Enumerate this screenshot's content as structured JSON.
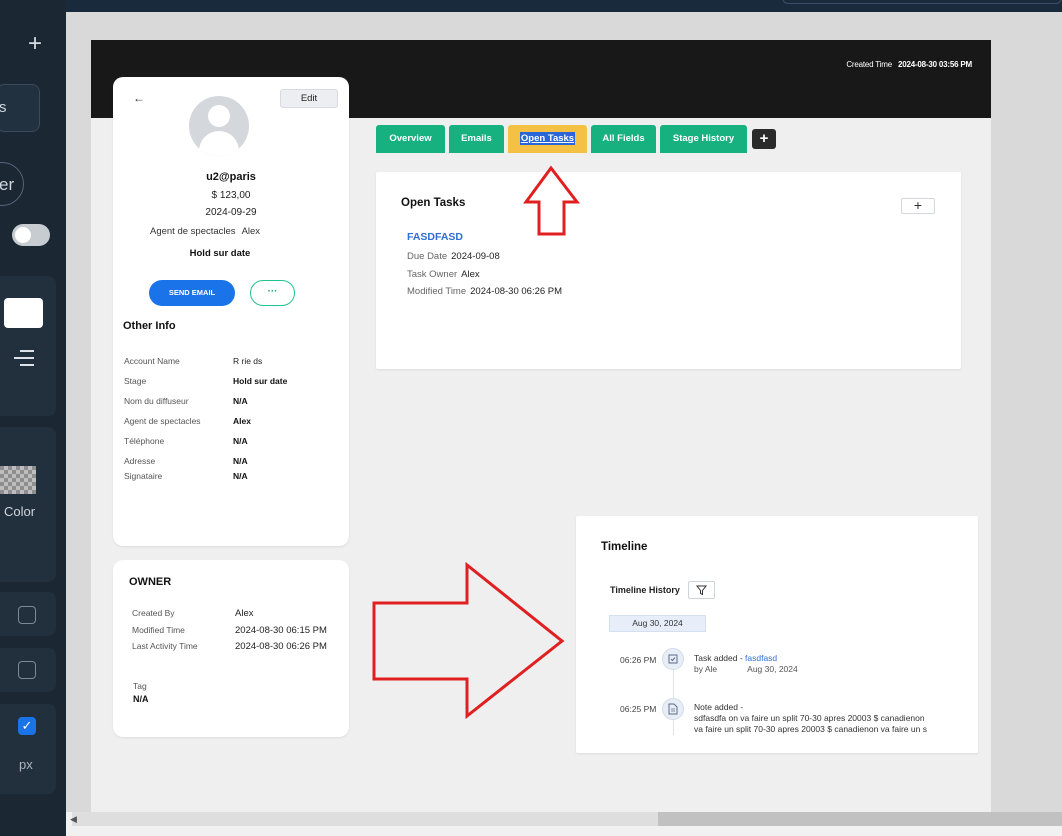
{
  "editor": {
    "sidebar_box_text": "s",
    "sidebar_circle_text": "er",
    "color_label": "Color",
    "unit_label": "px"
  },
  "header": {
    "created_label": "Created Time",
    "created_value": "2024-08-30 03:56 PM"
  },
  "profile": {
    "back_glyph": "←",
    "edit_label": "Edit",
    "name": "u2@paris",
    "amount": "$ 123,00",
    "date": "2024-09-29",
    "agent_label": "Agent de spectacles",
    "agent_value": "Alex",
    "stage": "Hold sur date",
    "send_email_label": "SEND EMAIL",
    "more_label": "···",
    "other_info_title": "Other Info",
    "fields": [
      {
        "label": "Account Name",
        "value": "R        rie          ds"
      },
      {
        "label": "Stage",
        "value": "Hold sur date"
      },
      {
        "label": "Nom du diffuseur",
        "value": "N/A"
      },
      {
        "label": "Agent de spectacles",
        "value": "Alex"
      },
      {
        "label": "Téléphone",
        "value": "N/A"
      },
      {
        "label": "Adresse",
        "value": "N/A"
      },
      {
        "label": "Signataire",
        "value": "N/A"
      }
    ]
  },
  "owner": {
    "title": "OWNER",
    "rows": [
      {
        "label": "Created By",
        "value": "Alex"
      },
      {
        "label": "Modified Time",
        "value": "2024-08-30 06:15 PM"
      },
      {
        "label": "Last Activity Time",
        "value": "2024-08-30 06:26 PM"
      }
    ],
    "tag_label": "Tag",
    "tag_value": "N/A"
  },
  "tabs": [
    {
      "label": "Overview"
    },
    {
      "label": "Emails"
    },
    {
      "label": "Open Tasks",
      "active": true
    },
    {
      "label": "All Fields"
    },
    {
      "label": "Stage History"
    }
  ],
  "tab_add_label": "+",
  "open_tasks": {
    "title": "Open Tasks",
    "add_label": "+",
    "task": {
      "name": "FASDFASD",
      "due_label": "Due Date",
      "due_value": "2024-09-08",
      "owner_label": "Task Owner",
      "owner_value": "Alex",
      "modified_label": "Modified Time",
      "modified_value": "2024-08-30 06:26 PM"
    }
  },
  "timeline": {
    "title": "Timeline",
    "history_label": "Timeline History",
    "date_chip": "Aug 30, 2024",
    "events": [
      {
        "time": "06:26 PM",
        "icon": "task-check-icon",
        "prefix": "Task added - ",
        "link": "fasdfasd",
        "by": "by Ale",
        "date": "Aug 30, 2024"
      },
      {
        "time": "06:25 PM",
        "icon": "note-doc-icon",
        "prefix": "Note added -",
        "line1": "sdfasdfa on va faire un split 70-30 apres 20003 $ canadienon",
        "line2": "va faire un split 70-30 apres 20003 $ canadienon va faire un s"
      }
    ]
  },
  "colors": {
    "tab_green": "#16b17e",
    "tab_active": "#f5c144",
    "primary_blue": "#1a73e8",
    "annotation_red": "#e02020"
  }
}
